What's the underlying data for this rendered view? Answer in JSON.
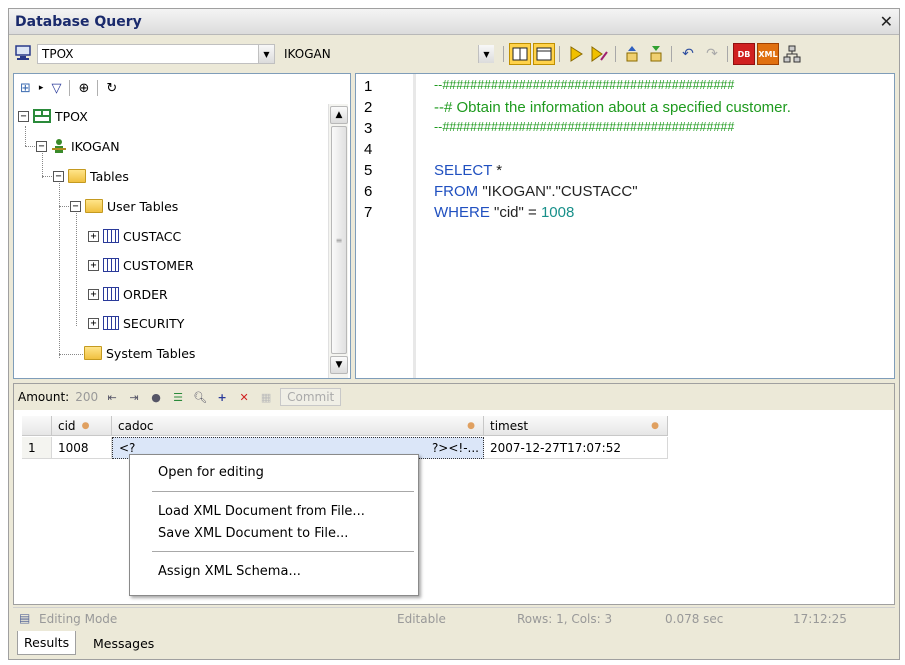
{
  "window": {
    "title": "Database Query"
  },
  "toolbar": {
    "database_combo": "TPOX",
    "schema_combo": "IKOGAN",
    "icons": [
      "layout-split-icon",
      "layout-tabs-icon",
      "run-icon",
      "run-step-icon",
      "export-icon",
      "import-icon",
      "undo-icon",
      "redo-icon",
      "db-clear-icon",
      "xml-icon",
      "network-icon"
    ]
  },
  "tree": {
    "toolbar_icons": [
      "add-node-icon",
      "filter-icon",
      "locate-icon",
      "refresh-icon"
    ],
    "nodes": [
      {
        "label": "TPOX",
        "expander": "−",
        "icon": "database-icon"
      },
      {
        "label": "IKOGAN",
        "expander": "−",
        "icon": "user-icon"
      },
      {
        "label": "Tables",
        "expander": "−",
        "icon": "folder-icon"
      },
      {
        "label": "User Tables",
        "expander": "−",
        "icon": "folder-icon"
      },
      {
        "label": "CUSTACC",
        "expander": "+",
        "icon": "table-icon"
      },
      {
        "label": "CUSTOMER",
        "expander": "+",
        "icon": "table-icon"
      },
      {
        "label": "ORDER",
        "expander": "+",
        "icon": "table-icon"
      },
      {
        "label": "SECURITY",
        "expander": "+",
        "icon": "table-icon"
      },
      {
        "label": "System Tables",
        "expander": "",
        "icon": "folder-icon"
      }
    ]
  },
  "editor": {
    "line_numbers": [
      "1",
      "2",
      "3",
      "4",
      "5",
      "6",
      "7"
    ],
    "lines": {
      "l1": "--##########################################",
      "l2": "--# Obtain the information about a specified customer.",
      "l3": "--##########################################",
      "l5_kw": "SELECT",
      "l5_rest": " *",
      "l6_kw": "FROM",
      "l6_rest": " \"IKOGAN\".\"CUSTACC\"",
      "l7_kw": "WHERE",
      "l7_rest": " \"cid\" = ",
      "l7_num": "1008"
    }
  },
  "results": {
    "amount_label": "Amount:",
    "amount_value": "200",
    "commit_label": "Commit",
    "columns": [
      "cid",
      "cadoc",
      "timest"
    ],
    "row_number": "1",
    "row": {
      "cid": "1008",
      "cadoc_start": "<?",
      "cadoc_end": "?><!-...",
      "timest": "2007-12-27T17:07:52"
    }
  },
  "context_menu": {
    "items": [
      "Open for editing",
      "Load XML Document from File...",
      "Save XML Document to File...",
      "Assign XML Schema..."
    ]
  },
  "status": {
    "mode": "Editing Mode",
    "editable": "Editable",
    "rows_cols": "Rows: 1, Cols: 3",
    "duration": "0.078 sec",
    "time": "17:12:25"
  },
  "tabs": [
    "Results",
    "Messages"
  ]
}
